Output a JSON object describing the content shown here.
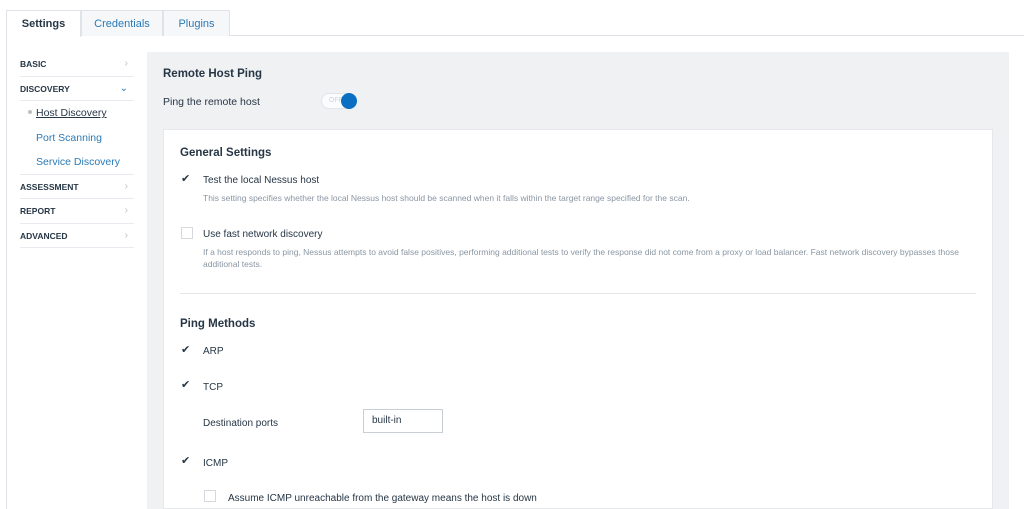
{
  "tabs": [
    {
      "label": "Settings"
    },
    {
      "label": "Credentials"
    },
    {
      "label": "Plugins"
    }
  ],
  "sidebar": {
    "items": [
      {
        "label": "BASIC"
      },
      {
        "label": "DISCOVERY"
      },
      {
        "label": "Host Discovery"
      },
      {
        "label": "Port Scanning"
      },
      {
        "label": "Service Discovery"
      },
      {
        "label": "ASSESSMENT"
      },
      {
        "label": "REPORT"
      },
      {
        "label": "ADVANCED"
      }
    ]
  },
  "main": {
    "title": "Remote Host Ping",
    "ping_label": "Ping the remote host",
    "toggle_off_text": "OFF",
    "general": {
      "title": "General Settings",
      "test_local": {
        "label": "Test the local Nessus host",
        "description": "This setting specifies whether the local Nessus host should be scanned when it falls within the target range specified for the scan.",
        "checked": true
      },
      "fast_discovery": {
        "label": "Use fast network discovery",
        "description": "If a host responds to ping, Nessus attempts to avoid false positives, performing additional tests to verify the response did not come from a proxy or load balancer. Fast network discovery bypasses those additional tests.",
        "checked": false
      }
    },
    "ping_methods": {
      "title": "Ping Methods",
      "arp": {
        "label": "ARP",
        "checked": true
      },
      "tcp": {
        "label": "TCP",
        "checked": true
      },
      "destination_ports_label": "Destination ports",
      "destination_ports_value": "built-in",
      "icmp": {
        "label": "ICMP",
        "checked": true
      },
      "assume_unreachable": {
        "label": "Assume ICMP unreachable from the gateway means the host is down",
        "checked": false
      }
    }
  },
  "colors": {
    "accent": "#0a6fc2",
    "link": "#2a7ab7",
    "panel": "#f0f1f3"
  }
}
